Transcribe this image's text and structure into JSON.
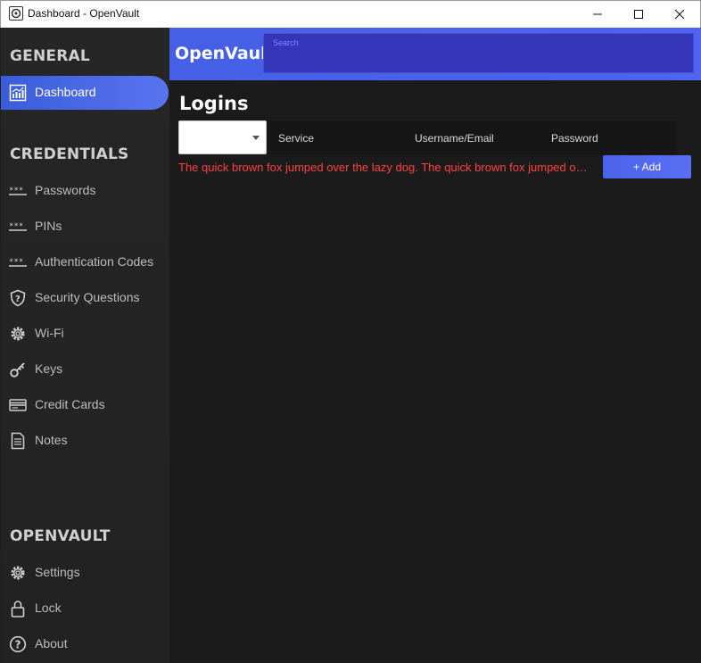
{
  "window": {
    "title": "Dashboard - OpenVault"
  },
  "sidebar": {
    "sections": [
      {
        "title": "GENERAL",
        "items": [
          {
            "label": "Dashboard",
            "icon": "dashboard-chart-icon",
            "active": true
          }
        ]
      },
      {
        "title": "CREDENTIALS",
        "items": [
          {
            "label": "Passwords",
            "icon": "password-dots-icon"
          },
          {
            "label": "PINs",
            "icon": "pin-dots-icon"
          },
          {
            "label": "Authentication Codes",
            "icon": "auth-code-dots-icon"
          },
          {
            "label": "Security Questions",
            "icon": "shield-question-icon"
          },
          {
            "label": "Wi-Fi",
            "icon": "gear-icon"
          },
          {
            "label": "Keys",
            "icon": "key-icon"
          },
          {
            "label": "Credit Cards",
            "icon": "credit-card-icon"
          },
          {
            "label": "Notes",
            "icon": "note-icon"
          }
        ]
      },
      {
        "title": "OPENVAULT",
        "items": [
          {
            "label": "Settings",
            "icon": "gear-icon"
          },
          {
            "label": "Lock",
            "icon": "lock-icon"
          },
          {
            "label": "About",
            "icon": "question-circle-icon"
          }
        ]
      }
    ]
  },
  "header": {
    "brand": "OpenVault",
    "search_label": "Search",
    "search_value": ""
  },
  "main": {
    "title": "Logins",
    "dropdown_value": "",
    "columns": [
      "Service",
      "Username/Email",
      "Password"
    ],
    "error_message": "The quick brown fox jumped over the lazy dog. The quick brown fox jumped over the lazy dog.",
    "add_button_label": "+ Add"
  },
  "colors": {
    "accent": "#4a63ea",
    "error": "#ff4040",
    "sidebar_bg": "#242424",
    "content_bg": "#1b1b1b"
  }
}
